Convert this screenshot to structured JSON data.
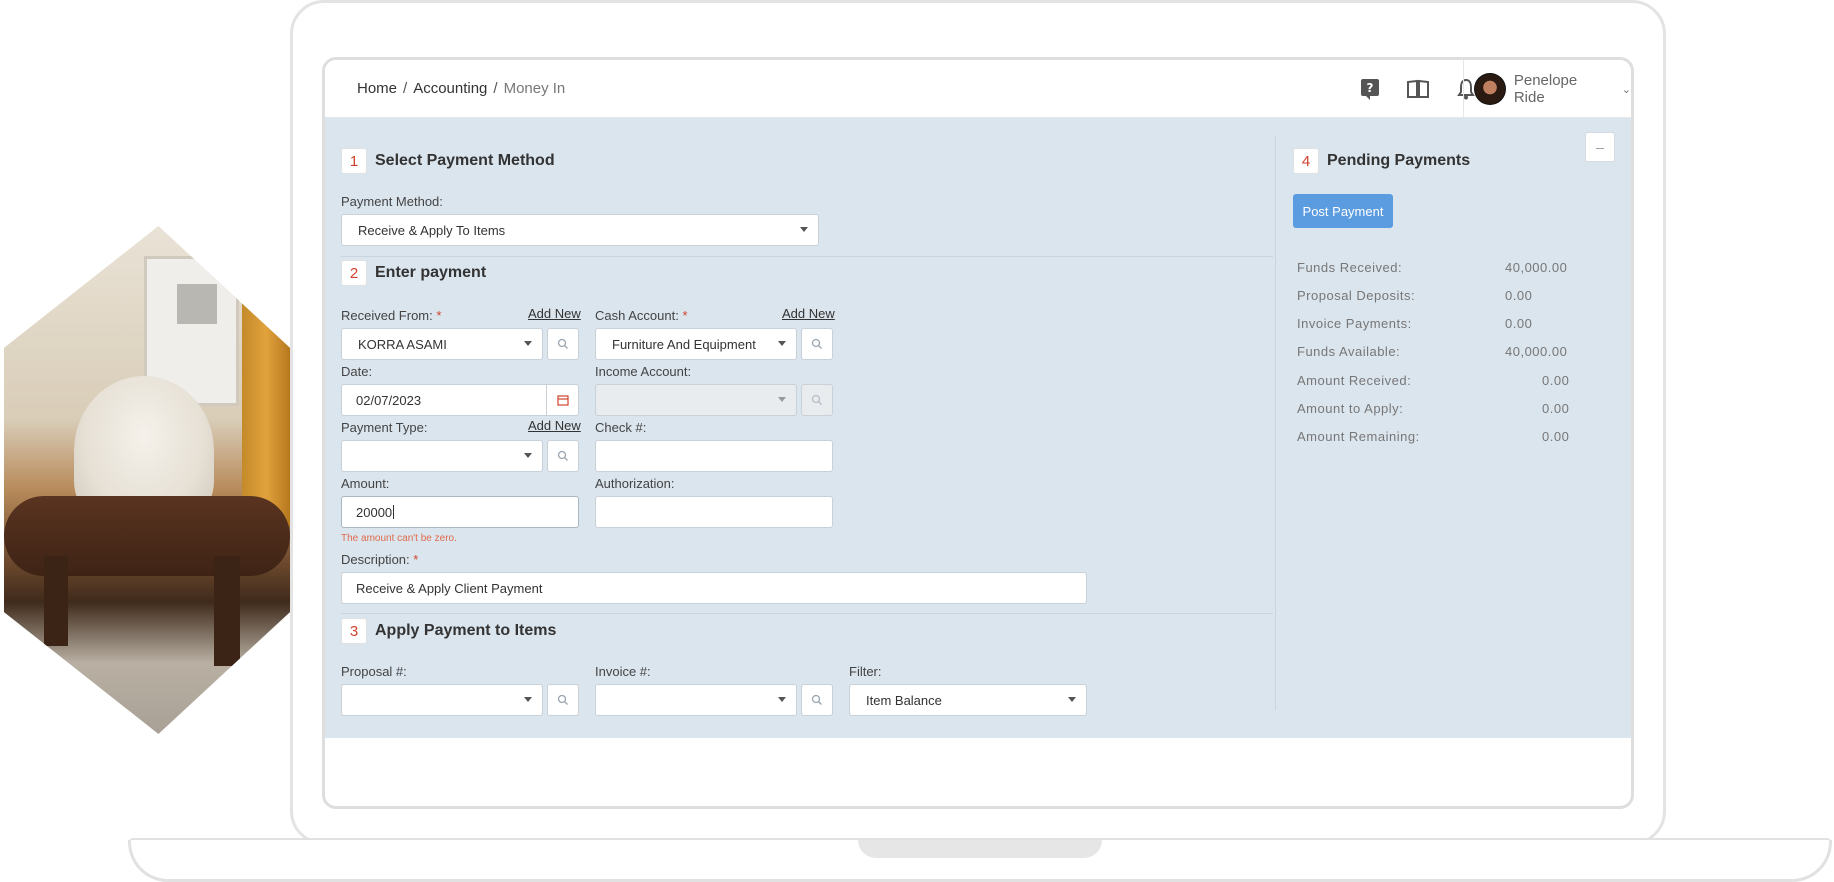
{
  "breadcrumb": {
    "home": "Home",
    "accounting": "Accounting",
    "current": "Money In"
  },
  "user": {
    "name": "Penelope Ride"
  },
  "icons": [
    "help-icon",
    "book-icon",
    "bell-icon",
    "chevron-down-icon",
    "search-icon",
    "calendar-icon"
  ],
  "colors": {
    "accent_red": "#d0422d",
    "primary_blue": "#5b9be0",
    "panel_bg": "#dbe5ee"
  },
  "step1": {
    "num": "1",
    "title": "Select Payment Method",
    "payment_method_label": "Payment Method:",
    "payment_method_value": "Receive & Apply To Items"
  },
  "step2": {
    "num": "2",
    "title": "Enter payment",
    "received_from_label": "Received From:",
    "received_from_value": "KORRA ASAMI",
    "add_new": "Add New",
    "cash_account_label": "Cash Account:",
    "cash_account_value": "Furniture And Equipment",
    "date_label": "Date:",
    "date_value": "02/07/2023",
    "income_account_label": "Income Account:",
    "payment_type_label": "Payment Type:",
    "check_label": "Check #:",
    "amount_label": "Amount:",
    "amount_value": "20000",
    "authorization_label": "Authorization:",
    "amount_error": "The amount can't be zero.",
    "description_label": "Description:",
    "description_value": "Receive & Apply Client Payment",
    "required_mark": "*"
  },
  "step3": {
    "num": "3",
    "title": "Apply Payment to Items",
    "proposal_label": "Proposal #:",
    "invoice_label": "Invoice #:",
    "filter_label": "Filter:",
    "filter_value": "Item Balance"
  },
  "step4": {
    "num": "4",
    "title": "Pending Payments",
    "post_button": "Post Payment",
    "collapse": "–",
    "rows": [
      {
        "label": "Funds Received:",
        "value": "40,000.00"
      },
      {
        "label": "Proposal Deposits:",
        "value": "0.00"
      },
      {
        "label": "Invoice Payments:",
        "value": "0.00"
      },
      {
        "label": "Funds Available:",
        "value": "40,000.00"
      },
      {
        "label": "Amount Received:",
        "value": "0.00"
      },
      {
        "label": "Amount to Apply:",
        "value": "0.00"
      },
      {
        "label": "Amount Remaining:",
        "value": "0.00"
      }
    ]
  }
}
